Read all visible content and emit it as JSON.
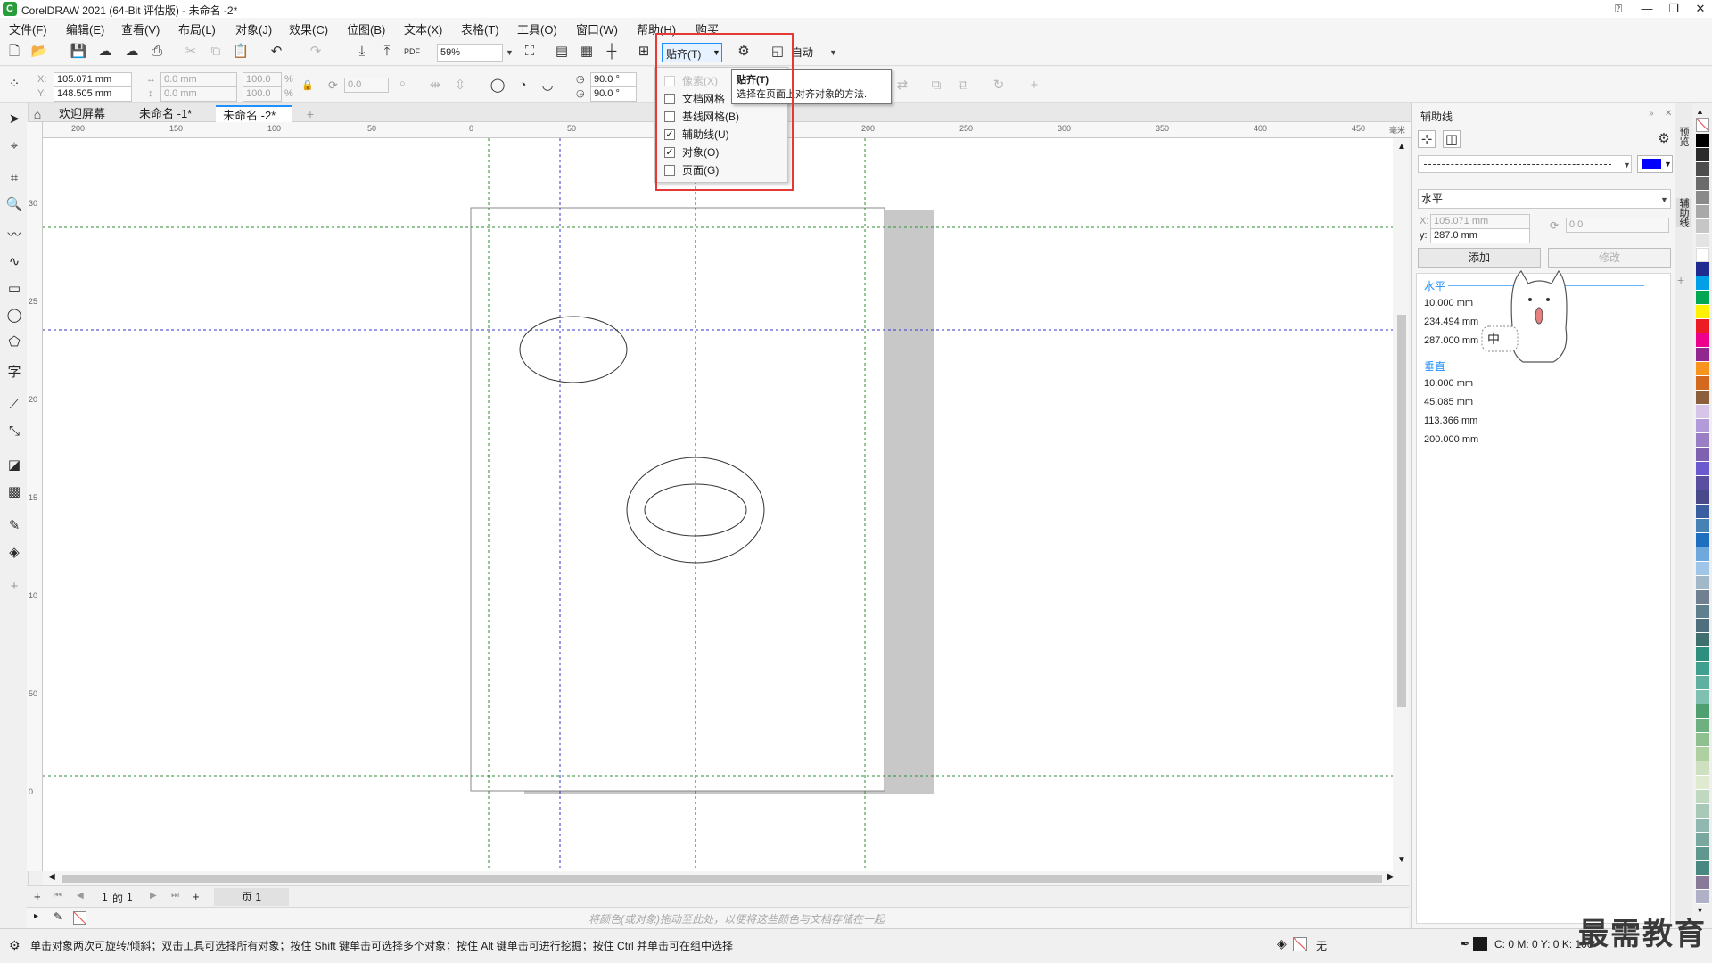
{
  "window": {
    "title": "CorelDRAW 2021 (64-Bit 评估版) - 未命名 -2*"
  },
  "menu": [
    "文件(F)",
    "编辑(E)",
    "查看(V)",
    "布局(L)",
    "对象(J)",
    "效果(C)",
    "位图(B)",
    "文本(X)",
    "表格(T)",
    "工具(O)",
    "窗口(W)",
    "帮助(H)",
    "购买"
  ],
  "toolbar": {
    "zoom_value": "59%",
    "snap_label": "贴齐(T)",
    "auto_label": "自动"
  },
  "propbar": {
    "x_label": "X:",
    "x_value": "105.071 mm",
    "y_label": "Y:",
    "y_value": "148.505 mm",
    "w_value": "0.0 mm",
    "h_value": "0.0 mm",
    "sx_value": "100.0",
    "sy_value": "100.0",
    "pct": "%",
    "rot_value": "0.0",
    "angle1": "90.0 °",
    "angle2": "90.0 °"
  },
  "snap_menu": {
    "items": [
      {
        "label": "像素(X)",
        "checked": false,
        "disabled": true
      },
      {
        "label": "文档网格",
        "checked": false,
        "disabled": false
      },
      {
        "label": "基线网格(B)",
        "checked": false,
        "disabled": false
      },
      {
        "label": "辅助线(U)",
        "checked": true,
        "disabled": false
      },
      {
        "label": "对象(O)",
        "checked": true,
        "disabled": false
      },
      {
        "label": "页面(G)",
        "checked": false,
        "disabled": false
      }
    ],
    "tooltip_title": "贴齐(T)",
    "tooltip_body": "选择在页面上对齐对象的方法."
  },
  "tabs": [
    "欢迎屏幕",
    "未命名 -1*",
    "未命名 -2*"
  ],
  "ruler": {
    "h_ticks": [
      "200",
      "150",
      "100",
      "50",
      "0",
      "50",
      "100",
      "150",
      "200",
      "250",
      "300",
      "350",
      "400",
      "450"
    ],
    "v_ticks": [
      "30",
      "25",
      "20",
      "15",
      "10",
      "50",
      "0"
    ],
    "unit": "毫米"
  },
  "pagebar": {
    "page_num": "1",
    "of": "的",
    "total": "1",
    "page_tab": "页 1"
  },
  "colorbar": {
    "hint": "将颜色(或对象)拖动至此处，以便将这些颜色与文档存储在一起"
  },
  "docker": {
    "title": "辅助线",
    "orientation": "水平",
    "x_value": "105.071 mm",
    "y_label": "y:",
    "y_value": "287.0 mm",
    "rot_value": "0.0",
    "add_label": "添加",
    "modify_label": "修改",
    "horizontal_header": "水平",
    "horizontal_values": [
      "10.000 mm",
      "234.494 mm",
      "287.000 mm"
    ],
    "vertical_header": "垂直",
    "vertical_values": [
      "10.000 mm",
      "45.085 mm",
      "113.366 mm",
      "200.000 mm"
    ],
    "side_tabs": [
      "预览",
      "辅助线"
    ],
    "sticker_text": "中"
  },
  "status": {
    "hint": "单击对象两次可旋转/倾斜；双击工具可选择所有对象；按住 Shift 键单击可选择多个对象；按住 Alt 键单击可进行挖掘；按住 Ctrl 并单击可在组中选择",
    "fill_label": "无",
    "cmyk": "C: 0 M: 0 Y: 0 K: 100"
  },
  "watermark": "最需教育",
  "colors": {
    "accent": "#1e90ff",
    "highlight_box": "#e53935",
    "guide_blue": "#3333cc",
    "guide_green": "#2e8b2e",
    "outline_color": "#0000ff"
  }
}
